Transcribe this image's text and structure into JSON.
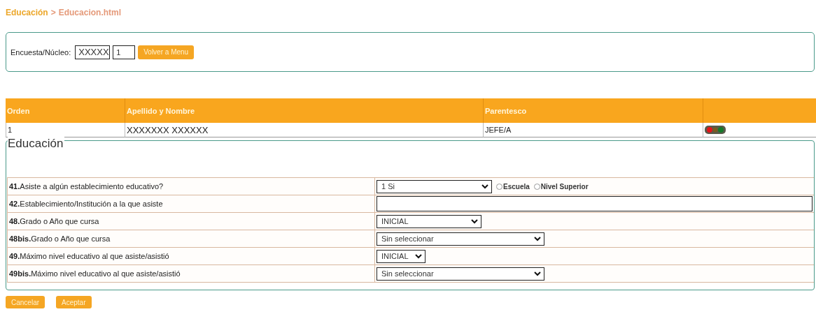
{
  "breadcrumb": {
    "section": "Educación",
    "separator": ">",
    "page": "Educacion.html"
  },
  "lookup": {
    "label": "Encuesta/Núcleo:",
    "survey_value": "XXXXX",
    "household_value": "1",
    "button": "Volver a Menu"
  },
  "members_table": {
    "columns": [
      "Orden",
      "Apellido y Nombre",
      "Parentesco"
    ],
    "rows": [
      {
        "orden": "1",
        "name": "XXXXXXX XXXXXX",
        "relationship": "JEFE/A"
      }
    ]
  },
  "education": {
    "legend": "Educación",
    "questions": [
      {
        "number": "41.",
        "label": "Asiste a algún establecimiento educativo?",
        "kind": "select",
        "value": "1 Si",
        "options": [
          {
            "label": "Escuela",
            "selected": false
          },
          {
            "label": "Nivel Superior",
            "selected": false
          }
        ]
      },
      {
        "number": "42.",
        "label": "Establecimiento/Institución a la que asiste",
        "kind": "text"
      },
      {
        "number": "48.",
        "label": "Grado o Año que cursa",
        "kind": "select",
        "value": "INICIAL"
      },
      {
        "number": "48bis.",
        "label": "Grado o Año que cursa",
        "kind": "select",
        "value": "Sin seleccionar"
      },
      {
        "number": "49.",
        "label": "Máximo nivel educativo al que asiste/asistió",
        "kind": "select",
        "value": "INICIAL"
      },
      {
        "number": "49bis.",
        "label": "Máximo nivel educativo al que asiste/asistió",
        "kind": "select",
        "value": "Sin seleccionar"
      }
    ]
  },
  "buttons": [
    "Cancelar",
    "Aceptar"
  ]
}
